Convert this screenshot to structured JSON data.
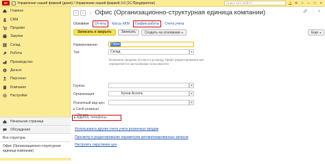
{
  "titlebar": {
    "logo": "1С",
    "title": "Управление нашей фирмой (демо) / Управление нашей фирмой 3.0 (1С:Предприятие)",
    "search_placeholder": "Поиск Ctrl+Shift+F"
  },
  "sidebar": {
    "items": [
      {
        "label": "Главное",
        "icon": "home-icon"
      },
      {
        "label": "CRM",
        "icon": "crm-icon"
      },
      {
        "label": "Продажи",
        "icon": "sales-icon"
      },
      {
        "label": "Закупки",
        "icon": "purchases-icon"
      },
      {
        "label": "Склад",
        "icon": "warehouse-icon"
      },
      {
        "label": "Работы",
        "icon": "works-icon"
      },
      {
        "label": "Производство",
        "icon": "production-icon"
      },
      {
        "label": "Деньги",
        "icon": "money-icon"
      },
      {
        "label": "Персонал",
        "icon": "personnel-icon"
      },
      {
        "label": "Компания",
        "icon": "company-icon"
      },
      {
        "label": "Настройки",
        "icon": "settings-icon"
      }
    ],
    "bottom": {
      "home_page": "Начальная страница",
      "discussions": "Обсуждения",
      "structure": "Все структура",
      "current_doc": "Офис (Организационно-структурная единица компании)"
    }
  },
  "main": {
    "title": "Офис (Организационно-структурная единица компании)",
    "tabs": {
      "main": "Основное",
      "reports": "Отчеты",
      "kkm": "Кассы ККМ",
      "schedule": "График работы",
      "accounts": "Счета учета"
    },
    "toolbar": {
      "save_close": "Записать и закрыть",
      "save": "Записать",
      "create_based": "Создать на основании"
    },
    "form": {
      "name_label": "Наименование:",
      "name_value": "Офис",
      "type_label": "Тип:",
      "type_value": "Склад",
      "hint": "Возможна продажа оптом и в розницу. Право редактирования цен определяется настройками пользователя",
      "group_label": "Группа:",
      "org_label": "Организация:",
      "org_value": "Кухни Ассоль",
      "retail_label": "Розничный вид цен:",
      "own_props": "Свой реквизит",
      "print": "Печать",
      "addresses": "Адреса, телефоны",
      "link1": "Использовать другие счета учета розничных продаж",
      "link2": "Просмотр и редактирование параметров автоматизированных запасов",
      "link3": "Настроить округление цен"
    },
    "more": "Еще"
  },
  "colors": {
    "panel_yellow": "#fbeb95",
    "primary_button": "#fce34a",
    "link_blue": "#2458b3",
    "highlight_red": "#cc0000"
  }
}
